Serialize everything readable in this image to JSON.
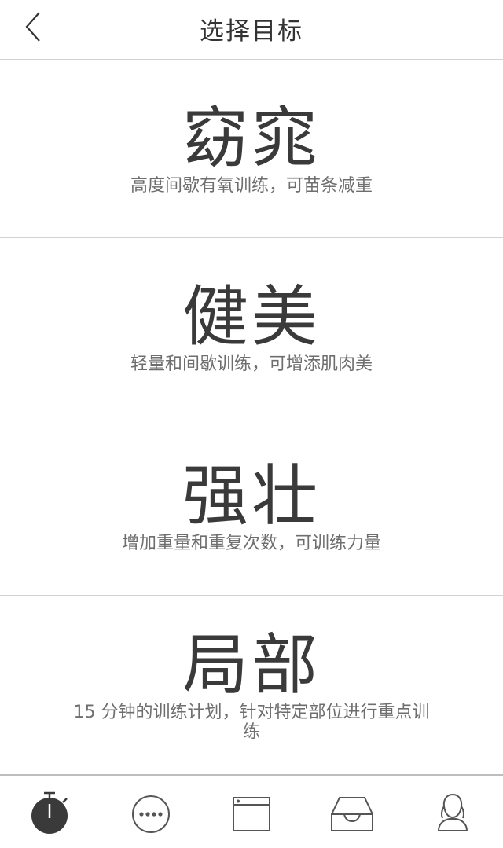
{
  "header": {
    "title": "选择目标"
  },
  "goals": [
    {
      "title": "窈窕",
      "description": "高度间歇有氧训练，可苗条减重"
    },
    {
      "title": "健美",
      "description": "轻量和间歇训练，可增添肌肉美"
    },
    {
      "title": "强壮",
      "description": "增加重量和重复次数，可训练力量"
    },
    {
      "title": "局部",
      "description": "15 分钟的训练计划，针对特定部位进行重点训练"
    }
  ],
  "tabbar": {
    "items": [
      {
        "icon": "stopwatch-icon",
        "active": true
      },
      {
        "icon": "more-dots-icon",
        "active": false
      },
      {
        "icon": "browser-window-icon",
        "active": false
      },
      {
        "icon": "inbox-tray-icon",
        "active": false
      },
      {
        "icon": "user-profile-icon",
        "active": false
      }
    ]
  },
  "colors": {
    "text": "#333333",
    "subtext": "#6e6e6e",
    "divider": "#d2d2d2",
    "icon": "#555555",
    "active_icon": "#3a3a3a"
  }
}
